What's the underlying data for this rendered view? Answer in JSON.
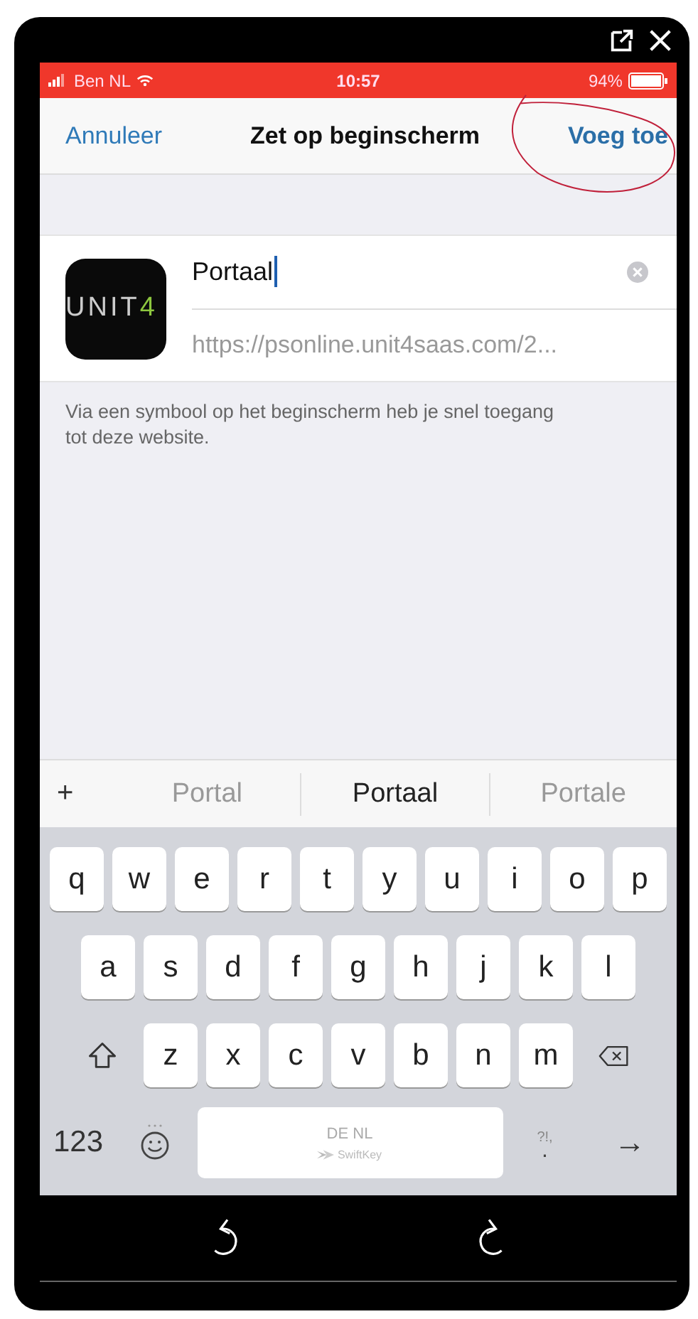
{
  "status_bar": {
    "carrier": "Ben NL",
    "time": "10:57",
    "battery": "94%"
  },
  "nav": {
    "cancel": "Annuleer",
    "title": "Zet op beginscherm",
    "add": "Voeg toe"
  },
  "app_icon": {
    "text": "UNIT",
    "accent": "4"
  },
  "name_field": {
    "value": "Portaal"
  },
  "url": "https://psonline.unit4saas.com/2...",
  "note": "Via een symbool op het beginscherm heb je snel toegang tot deze website.",
  "suggestions": {
    "plus": "+",
    "items": [
      {
        "text": "Portal",
        "selected": false
      },
      {
        "text": "Portaal",
        "selected": true
      },
      {
        "text": "Portale",
        "selected": false
      }
    ]
  },
  "keyboard": {
    "rows": [
      [
        "q",
        "w",
        "e",
        "r",
        "t",
        "y",
        "u",
        "i",
        "o",
        "p"
      ],
      [
        "a",
        "s",
        "d",
        "f",
        "g",
        "h",
        "j",
        "k",
        "l"
      ],
      [
        "z",
        "x",
        "c",
        "v",
        "b",
        "n",
        "m"
      ]
    ],
    "numbers": "123",
    "space_language": "DE NL",
    "space_brand": "SwiftKey",
    "punct_top": "?!,",
    "punct_bottom": ".",
    "enter": "→"
  }
}
